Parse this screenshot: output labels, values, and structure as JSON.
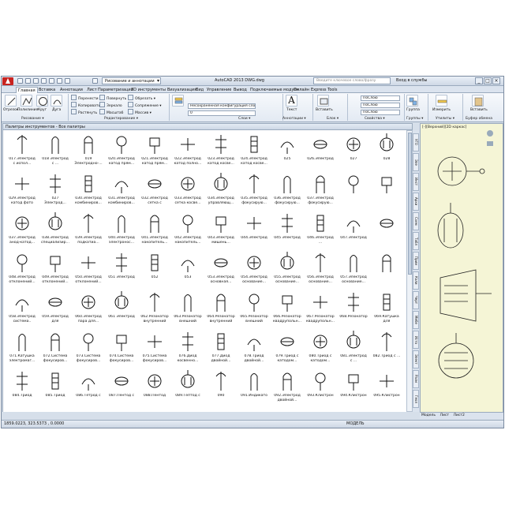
{
  "app": {
    "title": "AutoCAD 2013   DWG.dwg",
    "workspace": "Рисование и аннотации",
    "search_placeholder": "Введите ключевое слово/фразу",
    "login": "Вход в службы",
    "win_buttons": [
      "_",
      "□",
      "×"
    ]
  },
  "ribbon_tabs": [
    "Главная",
    "Вставка",
    "Аннотации",
    "Лист",
    "Параметризация",
    "3D инструменты",
    "Визуализация",
    "Вид",
    "Управление",
    "Вывод",
    "Подключаемые модули",
    "Онлайн",
    "Express Tools"
  ],
  "ribbon": {
    "draw": {
      "tools": [
        "Отрезок",
        "Полилиния",
        "Круг",
        "Дуга"
      ],
      "panel": "Рисование ▾"
    },
    "modify": {
      "tools": [
        "Перенести",
        "Копировать",
        "Растянуть",
        "Повернуть",
        "Зеркало",
        "Масштаб",
        "Обрезать ▾",
        "Сопряжение ▾",
        "Массив ▾"
      ],
      "panel": "Редактирование ▾"
    },
    "layers": {
      "combo1": "Несохраненная конфигурация сло",
      "combo2": "0",
      "panel": "Слои ▾"
    },
    "annotation": {
      "text": "Текст",
      "panel": "Аннотации ▾"
    },
    "block": {
      "insert": "Вставить",
      "panel": "Блок ▾"
    },
    "properties": {
      "bylayer": [
        "ПоСлою",
        "ПоСлою",
        "ПоСлою"
      ],
      "panel": "Свойства ▾"
    },
    "groups": {
      "label": "Группа",
      "panel": "Группы ▾"
    },
    "utilities": {
      "label": "Измерить",
      "panel": "Утилиты ▾"
    },
    "clipboard": {
      "label": "Вставить",
      "panel": "Буфер обмена"
    }
  },
  "palette": {
    "title": "Палитры инструментов - Все палитры",
    "rows": [
      [
        "017.Электрод с испол...",
        "018 Электрод с ...",
        "019 Электродно-...",
        "020.Электрод катод прям...",
        "021.Электрод катод прям...",
        "022.Электрод катод полно...",
        "023.Электрод катод косве...",
        "024.Электрод катод косве...",
        "025",
        "026.Электрод",
        "027",
        "028"
      ],
      [
        "029.Электрод катод фото",
        "027 Электрод...",
        "030.Электрод комбиниров...",
        "031.Электрод комбиниров...",
        "032.Электрод сетка с испол...",
        "033.Электрод сетка косве...",
        "034.Электрод управляющ...",
        "035.Электрод фокусирую...",
        "036.Электрод фокусирую...",
        "037.Электрод фокусирую...",
        "",
        ""
      ],
      [
        "037.Электрод анод-катод...",
        "038.Электрод специализир...",
        "039.Электрод подкатиа...",
        "040.Электрод электронос...",
        "041.Электрод накопитель...",
        "042.Электрод накопитель...",
        "043.Электрод мишень...",
        "044.Электрод",
        "045 Электрод",
        "046.Электрод ...",
        "047.Электрод",
        ""
      ],
      [
        "048.Электрод отклонений...",
        "049.Электрод отклонений...",
        "050.Электрод отклонений...",
        "051 Электрод",
        "052",
        "053",
        "053.Электрод основная...",
        "054.Электрод основание...",
        "055.Электрод основание...",
        "056.Электрод основание...",
        "057.Электрод основание...",
        ""
      ],
      [
        "058.Электрод система..",
        "059.Электрод для электрон...",
        "060.Электрод пара для...",
        "061 Электрод",
        "062.Резонатор внутренний",
        "063.Резонатор внешний",
        "064.Резонатор внутренний",
        "065.Резонатор внешний",
        "066.Резонатор квадрупольн...",
        "067.Резонатор квадрупольн...",
        "068.Резонатор",
        "069.Катушка для электрон..."
      ],
      [
        "071.Катушка электромаг...",
        "072.Система фокусиров...",
        "073.Система фокусиров...",
        "074.Система фокусиров...",
        "075.Система фокусиров...",
        "076.Диод косвенно...",
        "077.Диод двойной...",
        "078.Триод двойной...",
        "079.Триод с катодом...",
        "080.Триод с катодом...",
        "081.Электрод с ...",
        "082.Триод с ..."
      ],
      [
        "084.Триод",
        "085.Триод",
        "086.Тетрод с",
        "087.Пентод с",
        "088.Пентод",
        "089.Гептод с",
        "090",
        "091.Индикато",
        "092.Электрод двойной...",
        "093.Клистрон",
        "094.Клистрон",
        "095.Клистрон"
      ]
    ]
  },
  "side_tabs": [
    "УГО",
    "Эле",
    "Инст",
    "Архи",
    "Схем",
    "Табл",
    "Прим",
    "Коли",
    "Черт",
    "Мебе",
    "Исто",
    "Элект",
    "Разм",
    "Геол"
  ],
  "drawing": {
    "viewport": "[-][Верхний][2D каркас]",
    "tabs": [
      "Модель",
      "Лист",
      "Лист2"
    ]
  },
  "status": {
    "coords": "1859.0223, 323.5373 , 0.0000",
    "model": "МОДЕЛЬ"
  }
}
